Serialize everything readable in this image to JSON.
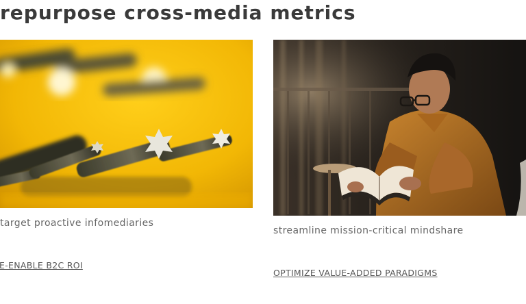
{
  "section": {
    "title": "repurpose cross-media metrics"
  },
  "cards": [
    {
      "image": "yellow-drill-bits-photo",
      "text": "target proactive infomediaries",
      "link": "E-ENABLE B2C ROI"
    },
    {
      "image": "man-reading-book-photo",
      "text": "streamline mission-critical mindshare",
      "link": "OPTIMIZE VALUE-ADDED PARADIGMS"
    }
  ],
  "colors": {
    "title": "#3a3a3a",
    "body_text": "#666666",
    "link": "#555555",
    "photo_yellow": "#f2b705",
    "photo_dark": "#2a2520"
  }
}
